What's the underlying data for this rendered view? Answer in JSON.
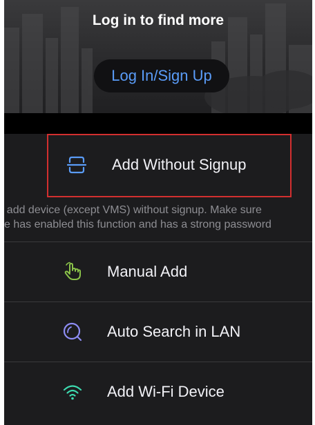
{
  "header": {
    "title": "Log in to find more",
    "login_button_label": "Log In/Sign Up"
  },
  "add_without_signup": {
    "label": "Add Without Signup",
    "icon": "scan-frame-icon",
    "hint_line_1": "to add device (except VMS) without signup. Make sure",
    "hint_line_2": "ce has enabled this function and has a strong password"
  },
  "options": [
    {
      "label": "Manual Add",
      "icon": "hand-pointer-icon"
    },
    {
      "label": "Auto Search in LAN",
      "icon": "search-icon"
    },
    {
      "label": "Add Wi-Fi Device",
      "icon": "wifi-icon"
    }
  ],
  "colors": {
    "accent_blue": "#5a9cf8",
    "highlight_red": "#d32f2f",
    "manual_green": "#8bc34a",
    "search_purple": "#8e8df5",
    "wifi_teal": "#3ddbb0"
  }
}
